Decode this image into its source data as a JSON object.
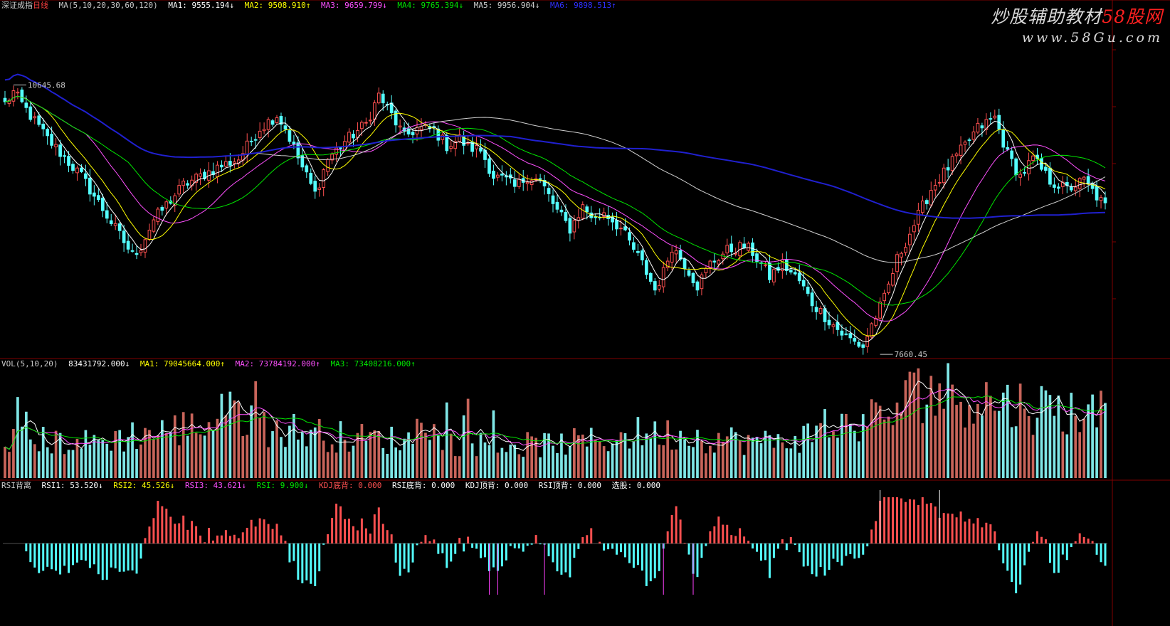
{
  "colors": {
    "up": "#ff5050",
    "up_body": "#000000",
    "down": "#54ffff",
    "vol_up": "#c8645a",
    "vol_down": "#7fe6e6",
    "ma1": "#ffffff",
    "ma2": "#ffff00",
    "ma3": "#ff50ff",
    "ma4": "#00e600",
    "ma5": "#d0d0d0",
    "ma6": "#2020d0",
    "frame": "#800000"
  },
  "header": {
    "index_name": "深证成指",
    "period": "日线",
    "ma_title": "MA(5,10,20,30,60,120)",
    "ma1": "MA1: 9555.194↓",
    "ma2": "MA2: 9508.910↑",
    "ma3": "MA3: 9659.799↓",
    "ma4": "MA4: 9765.394↓",
    "ma5": "MA5: 9956.904↓",
    "ma6": "MA6: 9898.513↑"
  },
  "vol_header": {
    "title": "VOL(5,10,20)",
    "vol": "83431792.000↓",
    "ma1": "MA1: 79045664.000↑",
    "ma2": "MA2: 73784192.000↑",
    "ma3": "MA3: 73408216.000↑"
  },
  "rsi_header": {
    "title": "RSI背离",
    "rsi1": "RSI1: 53.520↓",
    "rsi2": "RSI2: 45.526↓",
    "rsi3": "RSI3: 43.621↓",
    "rsi": "RSI: 9.900↓",
    "kdj_bottom": "KDJ底背: 0.000",
    "rsi_bottom": "RSI底背: 0.000",
    "kdj_top": "KDJ顶背: 0.000",
    "rsi_top": "RSI顶背: 0.000",
    "pick": "选股: 0.000"
  },
  "watermark": {
    "line1_a": "炒股辅助教材",
    "line1_b": "58股网",
    "line2": "www.58Gu.com"
  },
  "chart_data": [
    {
      "type": "candlestick",
      "title": "深证成指 日线",
      "series": [
        {
          "name": "MA1",
          "period": 5
        },
        {
          "name": "MA2",
          "period": 10
        },
        {
          "name": "MA3",
          "period": 20
        },
        {
          "name": "MA4",
          "period": 30
        },
        {
          "name": "MA5",
          "period": 60
        },
        {
          "name": "MA6",
          "period": 120
        }
      ],
      "annotations": [
        {
          "label": "10645.68",
          "bar": 2,
          "value": 10645.68,
          "kind": "high"
        },
        {
          "label": "7660.45",
          "bar": 206,
          "value": 7660.45,
          "kind": "low"
        }
      ],
      "ylim": [
        7580,
        11520
      ],
      "bar_count": 260,
      "close_path": [
        [
          0,
          10480
        ],
        [
          2,
          10610
        ],
        [
          10,
          10080
        ],
        [
          18,
          9650
        ],
        [
          26,
          9050
        ],
        [
          30,
          8750
        ],
        [
          32,
          8850
        ],
        [
          35,
          9150
        ],
        [
          42,
          9550
        ],
        [
          50,
          9750
        ],
        [
          55,
          9850
        ],
        [
          60,
          10200
        ],
        [
          64,
          10350
        ],
        [
          66,
          10200
        ],
        [
          70,
          9750
        ],
        [
          73,
          9450
        ],
        [
          76,
          9850
        ],
        [
          80,
          10050
        ],
        [
          85,
          10250
        ],
        [
          88,
          10580
        ],
        [
          91,
          10350
        ],
        [
          94,
          10100
        ],
        [
          97,
          10200
        ],
        [
          101,
          10180
        ],
        [
          104,
          10000
        ],
        [
          107,
          10080
        ],
        [
          109,
          9980
        ],
        [
          112,
          9950
        ],
        [
          115,
          9650
        ],
        [
          118,
          9600
        ],
        [
          120,
          9520
        ],
        [
          123,
          9650
        ],
        [
          126,
          9600
        ],
        [
          130,
          9250
        ],
        [
          133,
          9050
        ],
        [
          136,
          9300
        ],
        [
          139,
          9150
        ],
        [
          141,
          9250
        ],
        [
          145,
          9050
        ],
        [
          150,
          8650
        ],
        [
          153,
          8350
        ],
        [
          155,
          8550
        ],
        [
          157,
          8850
        ],
        [
          160,
          8650
        ],
        [
          163,
          8400
        ],
        [
          166,
          8650
        ],
        [
          170,
          8800
        ],
        [
          174,
          8850
        ],
        [
          176,
          8780
        ],
        [
          180,
          8500
        ],
        [
          183,
          8650
        ],
        [
          187,
          8450
        ],
        [
          190,
          8200
        ],
        [
          194,
          8000
        ],
        [
          197,
          7850
        ],
        [
          200,
          7750
        ],
        [
          202,
          7700
        ],
        [
          204,
          7950
        ],
        [
          207,
          8250
        ],
        [
          210,
          8700
        ],
        [
          214,
          9100
        ],
        [
          218,
          9500
        ],
        [
          222,
          9750
        ],
        [
          226,
          10000
        ],
        [
          229,
          10200
        ],
        [
          233,
          10320
        ],
        [
          236,
          9900
        ],
        [
          239,
          9650
        ],
        [
          242,
          9850
        ],
        [
          246,
          9600
        ],
        [
          250,
          9500
        ],
        [
          254,
          9600
        ],
        [
          257,
          9420
        ],
        [
          259,
          9300
        ]
      ]
    },
    {
      "type": "bar",
      "title": "VOL(5,10,20)",
      "values_desc": "daily volume, alternating up/down",
      "ylim": [
        0,
        140000000
      ],
      "vol_path": [
        [
          0,
          50
        ],
        [
          20,
          45
        ],
        [
          30,
          55
        ],
        [
          40,
          62
        ],
        [
          48,
          70
        ],
        [
          55,
          85
        ],
        [
          62,
          65
        ],
        [
          70,
          60
        ],
        [
          80,
          52
        ],
        [
          95,
          48
        ],
        [
          110,
          45
        ],
        [
          125,
          42
        ],
        [
          140,
          48
        ],
        [
          150,
          58
        ],
        [
          160,
          55
        ],
        [
          170,
          50
        ],
        [
          180,
          45
        ],
        [
          190,
          55
        ],
        [
          200,
          70
        ],
        [
          210,
          85
        ],
        [
          215,
          115
        ],
        [
          222,
          110
        ],
        [
          228,
          105
        ],
        [
          236,
          95
        ],
        [
          245,
          90
        ],
        [
          259,
          80
        ]
      ]
    },
    {
      "type": "bar",
      "title": "RSI背离",
      "values_desc": "oscillator above/below zero",
      "ylim": [
        -60,
        60
      ]
    }
  ]
}
